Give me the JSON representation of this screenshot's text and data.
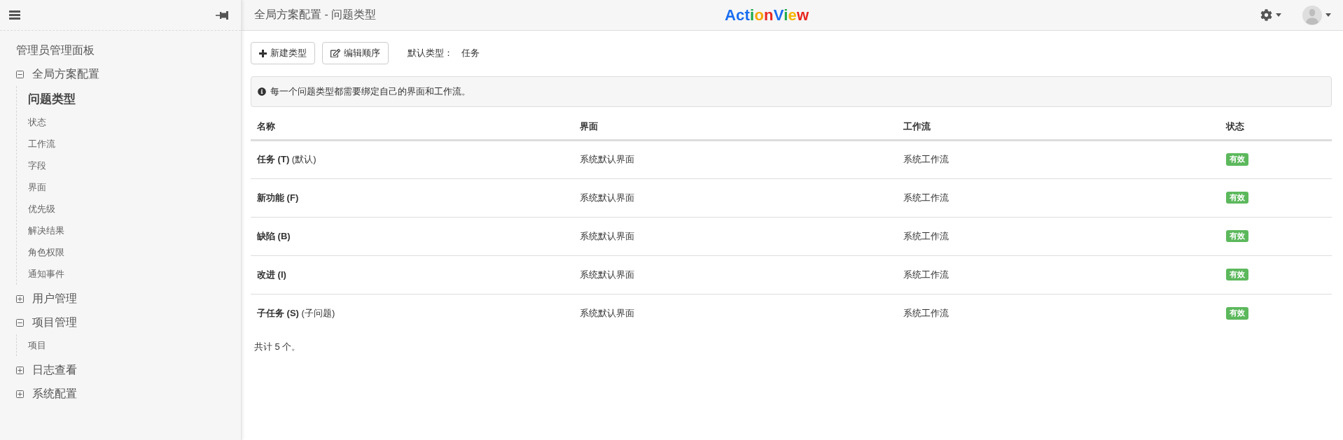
{
  "sidebar": {
    "title": "管理员管理面板",
    "groups": [
      {
        "label": "全局方案配置",
        "expanded": true,
        "children": [
          {
            "label": "问题类型",
            "selected": true
          },
          {
            "label": "状态",
            "selected": false
          },
          {
            "label": "工作流",
            "selected": false
          },
          {
            "label": "字段",
            "selected": false
          },
          {
            "label": "界面",
            "selected": false
          },
          {
            "label": "优先级",
            "selected": false
          },
          {
            "label": "解决结果",
            "selected": false
          },
          {
            "label": "角色权限",
            "selected": false
          },
          {
            "label": "通知事件",
            "selected": false
          }
        ]
      },
      {
        "label": "用户管理",
        "expanded": false
      },
      {
        "label": "项目管理",
        "expanded": true,
        "children": [
          {
            "label": "项目",
            "selected": false
          }
        ]
      },
      {
        "label": "日志查看",
        "expanded": false
      },
      {
        "label": "系统配置",
        "expanded": false
      }
    ]
  },
  "header": {
    "breadcrumb": "全局方案配置 - 问题类型",
    "logo": "ActionView"
  },
  "toolbar": {
    "buttons": [
      {
        "kind": "create",
        "label": "新建类型"
      },
      {
        "kind": "edit",
        "label": "编辑顺序"
      }
    ],
    "default_type": {
      "label": "默认类型：",
      "value": "任务"
    }
  },
  "notice": "每一个问题类型都需要绑定自己的界面和工作流。",
  "table": {
    "columns": [
      "名称",
      "界面",
      "工作流",
      "状态"
    ],
    "rows": [
      {
        "name": "**任务 (T)** (默认)",
        "screen": "系统默认界面",
        "workflow": "系统工作流",
        "status": "有效"
      },
      {
        "name": "**新功能 (F)**",
        "screen": "系统默认界面",
        "workflow": "系统工作流",
        "status": "有效"
      },
      {
        "name": "**缺陷 (B)**",
        "screen": "系统默认界面",
        "workflow": "系统工作流",
        "status": "有效"
      },
      {
        "name": "**改进 (I)**",
        "screen": "系统默认界面",
        "workflow": "系统工作流",
        "status": "有效"
      },
      {
        "name": "**子任务 (S)** (子问题)",
        "screen": "系统默认界面",
        "workflow": "系统工作流",
        "status": "有效"
      }
    ]
  },
  "footer": "共计 5 个。"
}
